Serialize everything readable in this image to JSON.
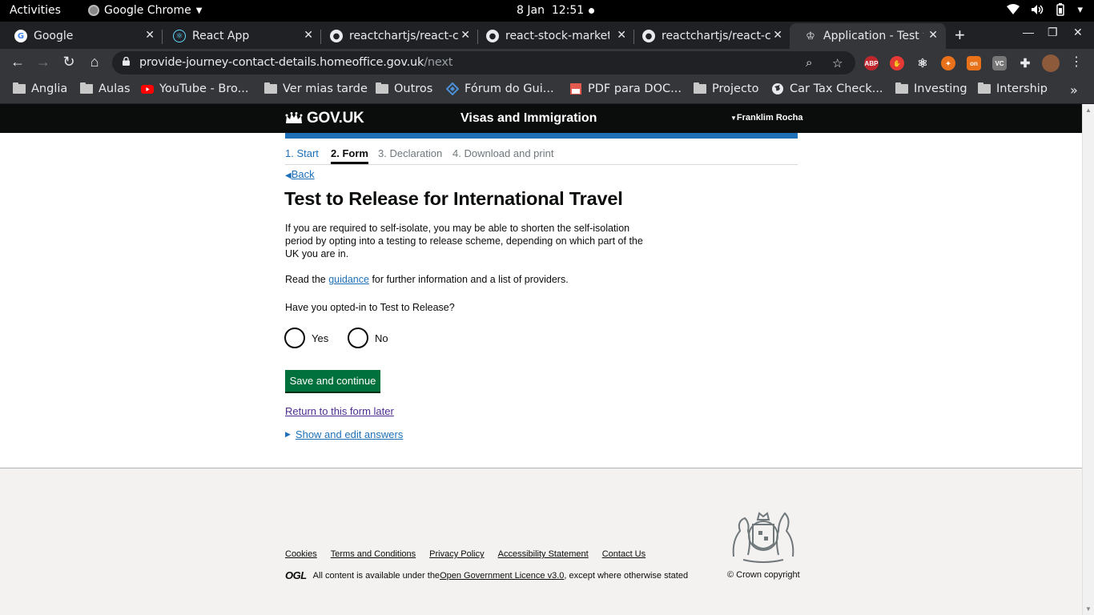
{
  "topbar": {
    "activities": "Activities",
    "app": "Google Chrome",
    "date": "8 Jan",
    "time": "12:51"
  },
  "tabs": [
    {
      "title": "Google",
      "icon": "google-icon"
    },
    {
      "title": "React App",
      "icon": "react-icon"
    },
    {
      "title": "reactchartjs/react-c",
      "icon": "github-icon"
    },
    {
      "title": "react-stock-market-",
      "icon": "github-icon"
    },
    {
      "title": "reactchartjs/react-c",
      "icon": "github-icon"
    },
    {
      "title": "Application - Test to",
      "icon": "govuk-crown-icon"
    }
  ],
  "toolbar": {
    "url_host": "provide-journey-contact-details.homeoffice.gov.uk",
    "url_path": "/next"
  },
  "bookmarks": [
    {
      "label": "Anglia",
      "type": "folder"
    },
    {
      "label": "Aulas",
      "type": "folder"
    },
    {
      "label": "YouTube - Bro...",
      "type": "youtube"
    },
    {
      "label": "Ver mias tarde",
      "type": "folder"
    },
    {
      "label": "Outros",
      "type": "folder"
    },
    {
      "label": "Fórum do Gui...",
      "type": "site"
    },
    {
      "label": "PDF para DOC...",
      "type": "pdf"
    },
    {
      "label": "Projecto",
      "type": "folder"
    },
    {
      "label": "Car Tax Check...",
      "type": "globe"
    },
    {
      "label": "Investing",
      "type": "folder"
    },
    {
      "label": "Intership",
      "type": "folder"
    }
  ],
  "gov": {
    "logo": "GOV.UK",
    "service": "Visas and Immigration",
    "user": "Franklim Rocha"
  },
  "steps": [
    {
      "label": "1. Start",
      "state": "link"
    },
    {
      "label": "2. Form",
      "state": "current"
    },
    {
      "label": "3. Declaration",
      "state": "inactive"
    },
    {
      "label": "4. Download and print",
      "state": "inactive"
    }
  ],
  "form": {
    "back": "Back",
    "title": "Test to Release for International Travel",
    "intro": "If you are required to self-isolate, you may be able to shorten the self-isolation period by opting into a testing to release scheme, depending on which part of the UK you are in.",
    "read_prefix": "Read the ",
    "read_link": "guidance",
    "read_suffix": " for further information and a list of providers.",
    "question": "Have you opted-in to Test to Release?",
    "option_yes": "Yes",
    "option_no": "No",
    "submit": "Save and continue",
    "return_link": "Return to this form later",
    "details": "Show and edit answers"
  },
  "footer": {
    "links": [
      "Cookies",
      "Terms and Conditions",
      "Privacy Policy",
      "Accessibility Statement",
      "Contact Us"
    ],
    "ogl": "OGL",
    "licence_prefix": "All content is available under the ",
    "licence_link": "Open Government Licence v3.0",
    "licence_suffix": ", except where otherwise stated",
    "copyright": "© Crown copyright"
  },
  "colors": {
    "gov_blue": "#1d70b8",
    "gov_green": "#00703c",
    "gov_black": "#0b0c0c",
    "footer_bg": "#f3f2f1"
  }
}
